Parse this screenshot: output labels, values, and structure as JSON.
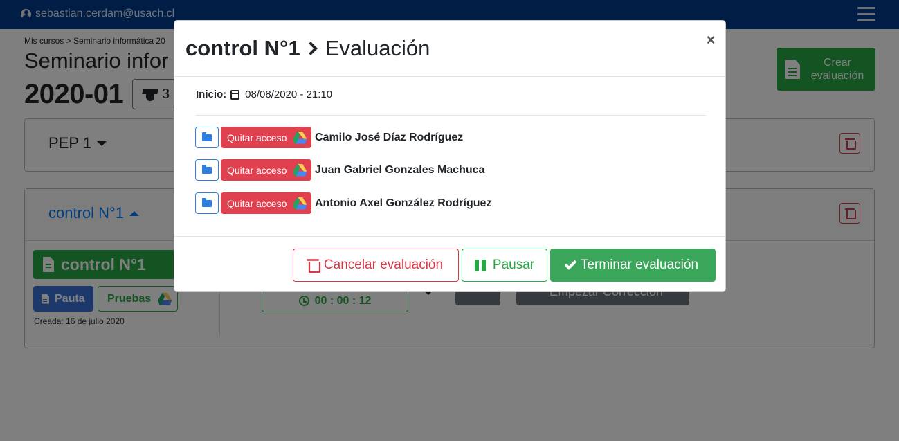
{
  "navbar": {
    "user_email": "sebastian.cerdam@usach.cl"
  },
  "page": {
    "breadcrumb": "Mis cursos > Seminario informática 20",
    "course_title": "Seminario infor",
    "course_code": "2020-01",
    "students_count": "3",
    "create_button": "Crear evaluación"
  },
  "sections": {
    "pep": {
      "title": "PEP 1"
    },
    "control": {
      "title": "control N°1",
      "doc_button": "control N°1",
      "pauta_button": "Pauta",
      "pruebas_button": "Pruebas",
      "created": "Creada: 16 de julio 2020",
      "timer": "00 : 00 : 12",
      "correction_button": "Empezar Corrección"
    }
  },
  "modal": {
    "title_main": "control N°1",
    "title_sub": "Evaluación",
    "close_label": "×",
    "inicio_label": "Inicio:",
    "inicio_value": "08/08/2020 - 21:10",
    "students": [
      {
        "name": "Camilo José Díaz Rodríguez",
        "action": "Quitar acceso"
      },
      {
        "name": "Juan Gabriel Gonzales Machuca",
        "action": "Quitar acceso"
      },
      {
        "name": "Antonio Axel González Rodríguez",
        "action": "Quitar acceso"
      }
    ],
    "buttons": {
      "cancel": "Cancelar evaluación",
      "pause": "Pausar",
      "finish": "Terminar evaluación"
    }
  },
  "colors": {
    "navbar": "#003a8c",
    "success": "#28a745",
    "danger": "#dc3545",
    "primary": "#007bff"
  },
  "icons": [
    "user-circle-icon",
    "hamburger-icon",
    "file-icon",
    "graduation-cap-icon",
    "caret-down-icon",
    "caret-up-icon",
    "trash-icon",
    "google-drive-icon",
    "clock-icon",
    "calendar-icon",
    "folder-open-icon",
    "chevron-right-icon",
    "pause-icon",
    "check-icon",
    "close-icon"
  ]
}
